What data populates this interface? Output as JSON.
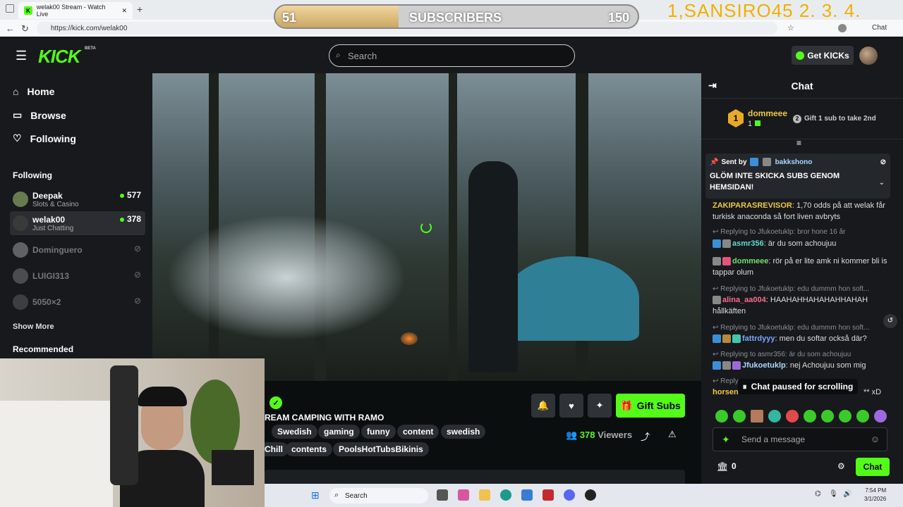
{
  "browser": {
    "tab_title": "welak00 Stream - Watch Live",
    "url": "https://kick.com/welak00",
    "chat_ext": "Chat"
  },
  "overlay": {
    "sub_current": "51",
    "sub_label": "SUBSCRIBERS",
    "sub_goal": "150",
    "sub_progress": 0.34,
    "goal_text": "1,SANSIRO45   2. 3. 4."
  },
  "header": {
    "logo": "KICK",
    "beta": "BETA",
    "search_placeholder": "Search",
    "getkicks": "Get KICKs"
  },
  "sidebar": {
    "nav": [
      {
        "label": "Home",
        "icon": "home-icon"
      },
      {
        "label": "Browse",
        "icon": "browse-icon"
      },
      {
        "label": "Following",
        "icon": "heart-icon"
      }
    ],
    "following_title": "Following",
    "channels": [
      {
        "name": "Deepak",
        "sub": "Slots & Casino",
        "viewers": "577",
        "live": true
      },
      {
        "name": "welak00",
        "sub": "Just Chatting",
        "viewers": "378",
        "live": true
      },
      {
        "name": "Dominguero",
        "sub": "",
        "viewers": "",
        "live": false
      },
      {
        "name": "LUIGI313",
        "sub": "",
        "viewers": "",
        "live": false
      },
      {
        "name": "5050×2",
        "sub": "",
        "viewers": "",
        "live": false
      }
    ],
    "show_more": "Show More",
    "recommended": "Recommended"
  },
  "stream": {
    "title": "REAM CAMPING WITH RAMO",
    "tags_row1": [
      "Swedish",
      "gaming",
      "funny",
      "content",
      "swedish"
    ],
    "tags_row2": [
      "Chill",
      "contents",
      "PoolsHotTubsBikinis"
    ],
    "viewers": "378",
    "viewers_label": "Viewers",
    "gift_subs": "Gift Subs"
  },
  "chat": {
    "title": "Chat",
    "top_gifter": {
      "rank": "1",
      "name": "dommeee",
      "count": "1",
      "second_label": "Gift 1 sub to take 2nd"
    },
    "pinned": {
      "sent_by": "Sent by",
      "user": "bakkshono",
      "text": "GLÖM INTE SKICKA SUBS GENOM HEMSIDAN!"
    },
    "messages": [
      {
        "reply": "",
        "user": "ZAKIPARASREVISOR",
        "color": "#f0c846",
        "text": "1,70 odds på att welak får turkisk anaconda så fort liven avbryts"
      },
      {
        "reply": "Replying to Jfukoetuklp: bror hone 16 år",
        "user": "asmr356",
        "color": "#63d7d0",
        "text": "är du som achoujuu"
      },
      {
        "reply": "",
        "user": "dommeee",
        "color": "#6ee36a",
        "text": "rör på er lite amk ni kommer bli is tappar olum"
      },
      {
        "reply": "Replying to Jfukoetuklp: edu dummm hon soft...",
        "user": "alina_aa004",
        "color": "#ff6b8a",
        "text": "HAAHAHHAHAHAHHAHAH hållkäften"
      },
      {
        "reply": "Replying to Jfukoetuklp: edu dummm hon soft...",
        "user": "fattrdyyy",
        "color": "#7aa8ff",
        "text": "men du softar också där?"
      },
      {
        "reply": "Replying to asmr356: är du som achoujuu",
        "user": "Jfukoetuklp",
        "color": "#a8d8ff",
        "text": "nej Achoujuu som mig"
      },
      {
        "reply": "Reply",
        "user": "horsen",
        "color": "#f0c846",
        "text": "** xD"
      }
    ],
    "paused": "Chat paused for scrolling",
    "send_placeholder": "Send a message",
    "kicks_count": "0",
    "chat_button": "Chat"
  },
  "taskbar": {
    "search": "Search",
    "time": "7:54 PM",
    "date": "3/1/2026"
  }
}
